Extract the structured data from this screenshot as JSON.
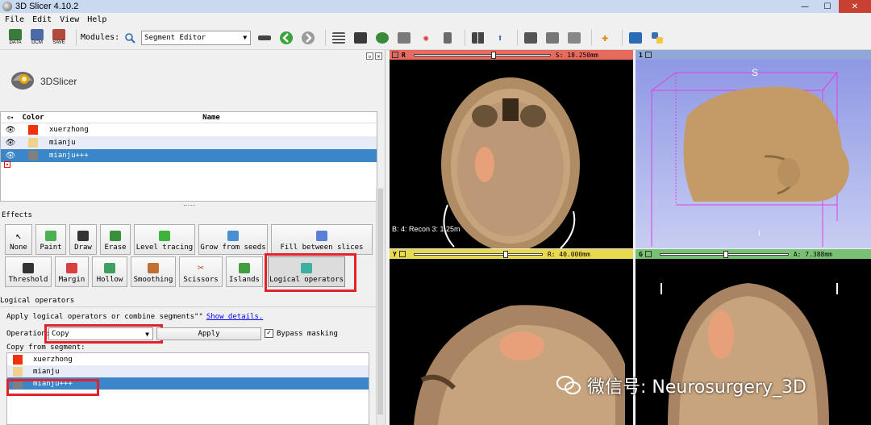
{
  "window": {
    "title": "3D Slicer 4.10.2",
    "controls": {
      "minimize": "—",
      "maximize": "☐",
      "close": "✕"
    }
  },
  "menu": [
    "File",
    "Edit",
    "View",
    "Help"
  ],
  "toolbar": {
    "data_label": "DATA",
    "dcm_label": "DCM",
    "save_label": "SAVE",
    "modules_label": "Modules:",
    "module_selected": "Segment Editor"
  },
  "logo_text": "3DSlicer",
  "segments": {
    "headers": {
      "eye": "⊙▾",
      "color": "Color",
      "name": "Name"
    },
    "rows": [
      {
        "name": "xuerzhong",
        "color": "#f0320a"
      },
      {
        "name": "mianju",
        "color": "#f0d28c"
      },
      {
        "name": "mianju+++",
        "color": "#808080"
      }
    ]
  },
  "effects": {
    "label": "Effects",
    "buttons": [
      {
        "label": "None",
        "icon": "cursor-icon",
        "color": "#f0f0f0"
      },
      {
        "label": "Paint",
        "icon": "paint-brush-icon",
        "color": "#4caf50"
      },
      {
        "label": "Draw",
        "icon": "pencil-icon",
        "color": "#333333"
      },
      {
        "label": "Erase",
        "icon": "eraser-icon",
        "color": "#3a8f3a"
      },
      {
        "label": "Level tracing",
        "icon": "level-tracing-icon",
        "color": "#3cb43c"
      },
      {
        "label": "Grow from seeds",
        "icon": "grow-seeds-icon",
        "color": "#4a8fd0"
      },
      {
        "label": "Fill between slices",
        "icon": "fill-slices-icon",
        "color": "#5a7fd4"
      },
      {
        "label": "Threshold",
        "icon": "threshold-icon",
        "color": "#333333"
      },
      {
        "label": "Margin",
        "icon": "margin-icon",
        "color": "#d94040"
      },
      {
        "label": "Hollow",
        "icon": "hollow-icon",
        "color": "#40a060"
      },
      {
        "label": "Smoothing",
        "icon": "smoothing-icon",
        "color": "#c07030"
      },
      {
        "label": "Scissors",
        "icon": "scissors-icon",
        "color": "#c03030"
      },
      {
        "label": "Islands",
        "icon": "islands-icon",
        "color": "#40a040"
      },
      {
        "label": "Logical operators",
        "icon": "logical-operators-icon",
        "color": "#3ab0a0"
      }
    ]
  },
  "logical": {
    "section_label": "Logical operators",
    "description": "Apply logical operators or combine segments\"\"",
    "details_link": "Show details.",
    "operation_label": "Operation:",
    "operation_value": "Copy",
    "apply_label": "Apply",
    "bypass_label": "Bypass masking",
    "bypass_checked": "✓",
    "copy_from_label": "Copy from segment:",
    "copy_rows": [
      {
        "name": "xuerzhong",
        "color": "#f0320a"
      },
      {
        "name": "mianju",
        "color": "#f0d28c"
      },
      {
        "name": "mianju+++",
        "color": "#808080"
      }
    ]
  },
  "views": {
    "red": {
      "letter": "R",
      "readout": "S: 18.250mm",
      "caption": "B: 4: Recon 3: 1.25m"
    },
    "threed": {
      "letter": "1",
      "orientation": "S"
    },
    "yellow": {
      "letter": "Y",
      "readout": "R: 40.000mm"
    },
    "green": {
      "letter": "G",
      "readout": "A: 7.388mm"
    }
  },
  "watermark": "微信号: Neurosurgery_3D"
}
